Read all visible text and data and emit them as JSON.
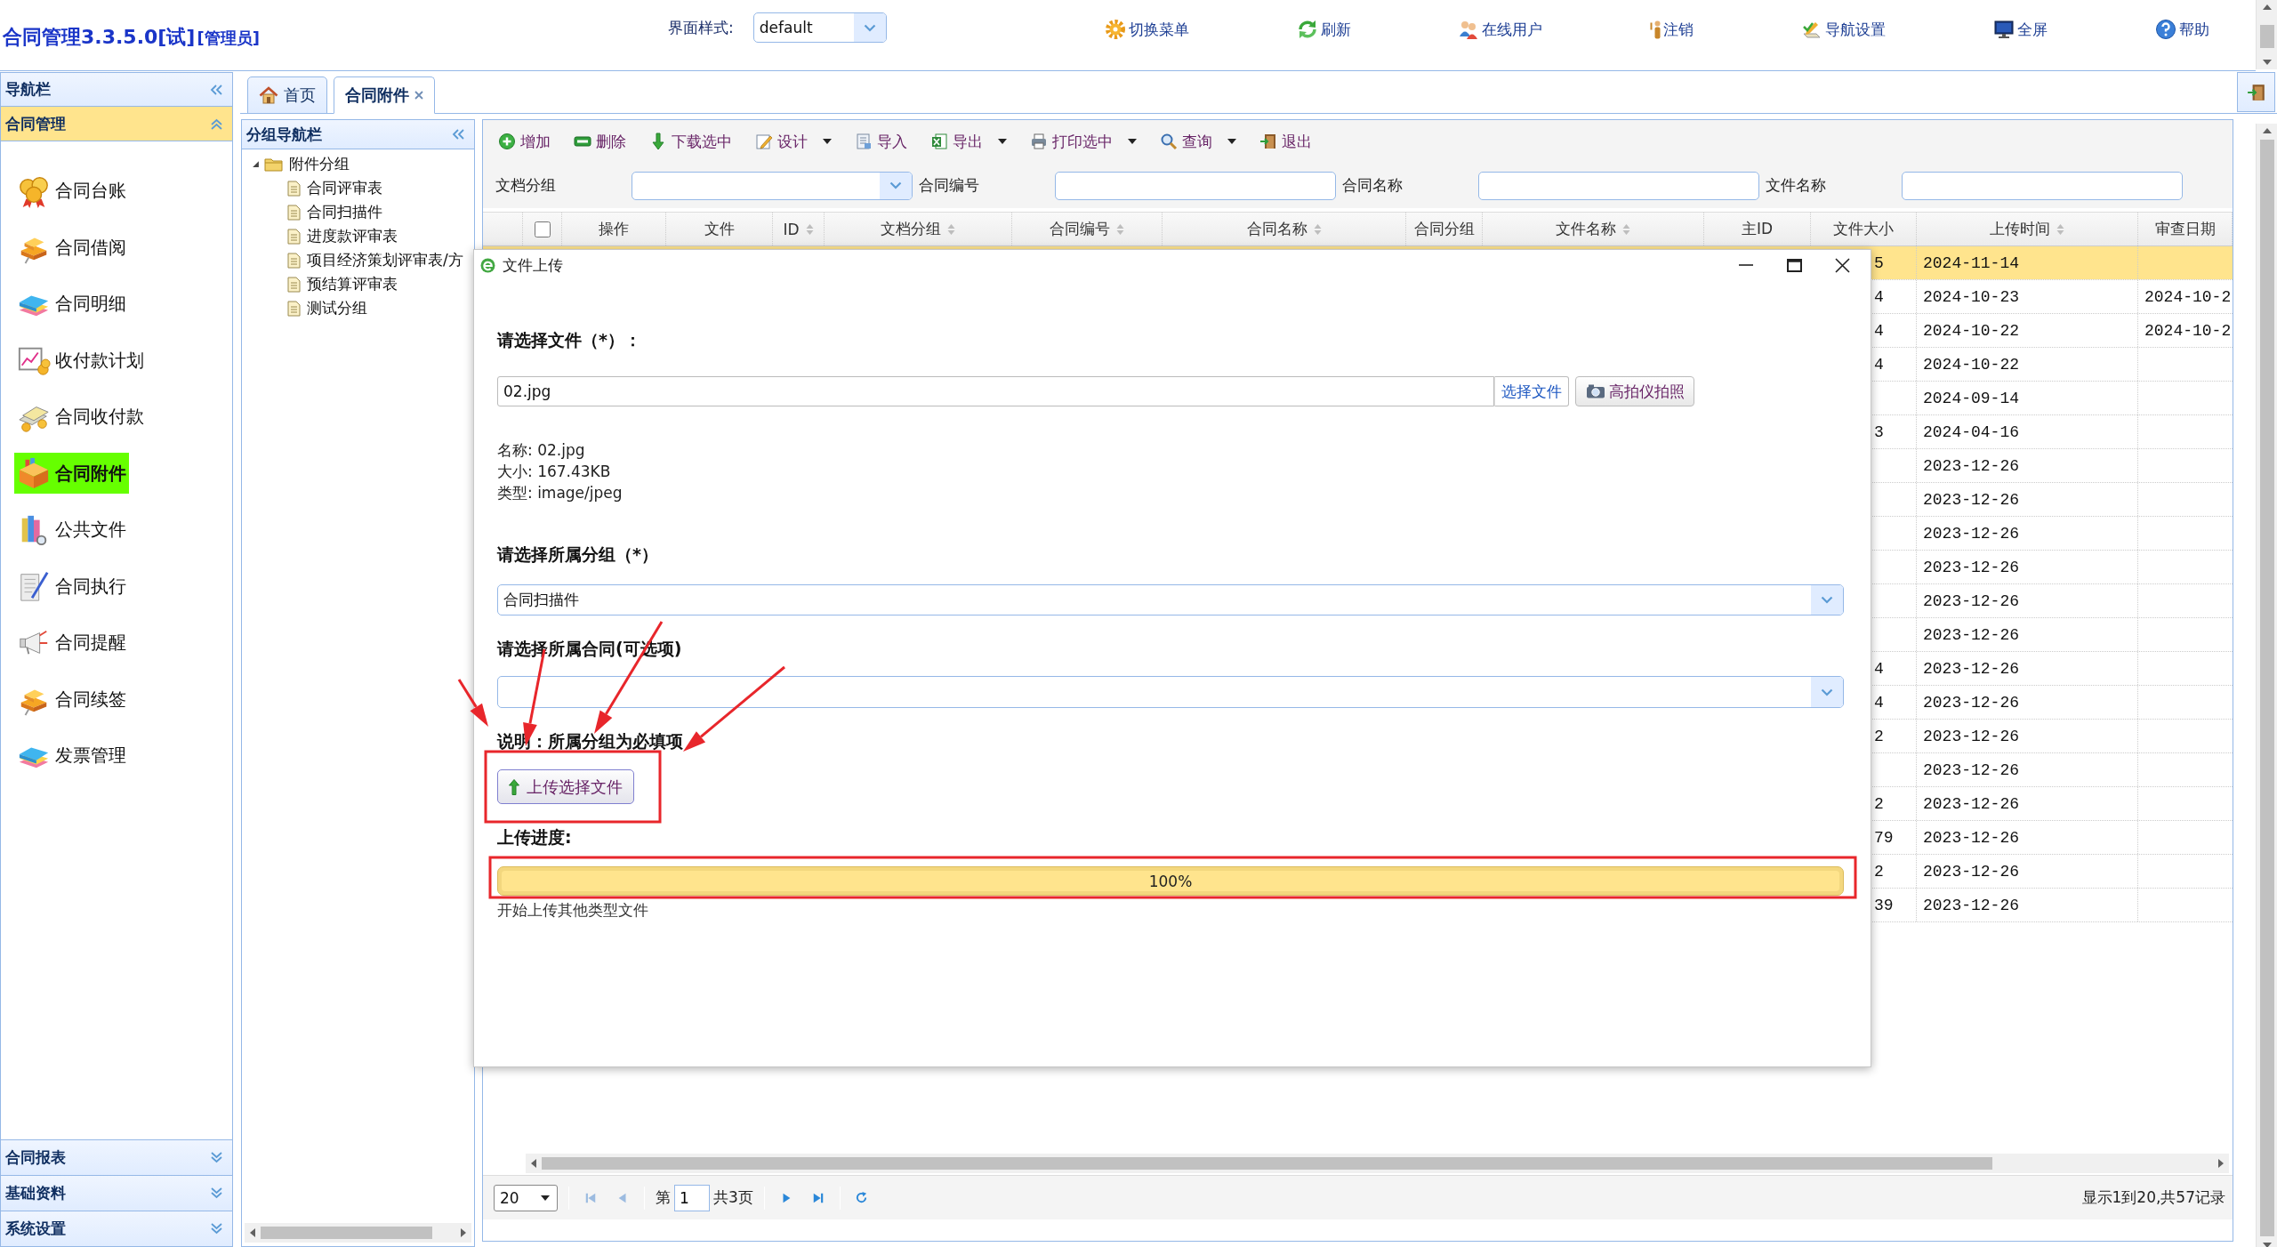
{
  "header": {
    "title": "合同管理3.3.5.0[试]",
    "role": "[管理员]",
    "theme_label": "界面样式:",
    "theme_value": "default",
    "actions": [
      "切换菜单",
      "刷新",
      "在线用户",
      "注销",
      "导航设置",
      "全屏",
      "帮助"
    ]
  },
  "nav": {
    "title": "导航栏",
    "group": {
      "label": "合同管理",
      "expanded": true
    },
    "items": [
      {
        "label": "合同台账",
        "selected": false
      },
      {
        "label": "合同借阅",
        "selected": false
      },
      {
        "label": "合同明细",
        "selected": false
      },
      {
        "label": "收付款计划",
        "selected": false
      },
      {
        "label": "合同收付款",
        "selected": false
      },
      {
        "label": "合同附件",
        "selected": true
      },
      {
        "label": "公共文件",
        "selected": false
      },
      {
        "label": "合同执行",
        "selected": false
      },
      {
        "label": "合同提醒",
        "selected": false
      },
      {
        "label": "合同续签",
        "selected": false
      },
      {
        "label": "发票管理",
        "selected": false
      }
    ],
    "sections": [
      {
        "label": "合同报表",
        "expanded": false
      },
      {
        "label": "基础资料",
        "expanded": false
      },
      {
        "label": "系统设置",
        "expanded": false
      }
    ]
  },
  "tabs": [
    {
      "label": "首页",
      "kind": "home",
      "selected": false,
      "closable": false
    },
    {
      "label": "合同附件",
      "kind": "page",
      "selected": true,
      "closable": true
    }
  ],
  "group_nav": {
    "title": "分组导航栏",
    "tree": [
      {
        "label": "附件分组",
        "expanded": true,
        "children": [
          {
            "label": "合同评审表"
          },
          {
            "label": "合同扫描件"
          },
          {
            "label": "进度款评审表"
          },
          {
            "label": "项目经济策划评审表/方"
          },
          {
            "label": "预结算评审表"
          },
          {
            "label": "测试分组"
          }
        ]
      }
    ]
  },
  "toolbar": [
    {
      "label": "增加",
      "menu": false
    },
    {
      "label": "删除",
      "menu": false
    },
    {
      "label": "下载选中",
      "menu": false
    },
    {
      "label": "设计",
      "menu": true
    },
    {
      "label": "导入",
      "menu": false
    },
    {
      "label": "导出",
      "menu": true
    },
    {
      "label": "打印选中",
      "menu": true
    },
    {
      "label": "查询",
      "menu": true
    },
    {
      "label": "退出",
      "menu": false
    }
  ],
  "filters": [
    {
      "label": "文档分组",
      "kind": "select"
    },
    {
      "label": "合同编号",
      "kind": "text"
    },
    {
      "label": "合同名称",
      "kind": "text"
    },
    {
      "label": "文件名称",
      "kind": "text"
    }
  ],
  "table": {
    "select_all": {
      "checked": false
    },
    "columns": [
      {
        "label": "操作",
        "sortable": false
      },
      {
        "label": "文件",
        "sortable": false
      },
      {
        "label": "ID",
        "sortable": true
      },
      {
        "label": "文档分组",
        "sortable": true
      },
      {
        "label": "合同编号",
        "sortable": true
      },
      {
        "label": "合同名称",
        "sortable": true
      },
      {
        "label": "合同分组",
        "sortable": false
      },
      {
        "label": "文件名称",
        "sortable": true
      },
      {
        "label": "主ID",
        "sortable": false
      },
      {
        "label": "文件大小",
        "sortable": false
      },
      {
        "label": "上传时间",
        "sortable": true
      },
      {
        "label": "审查日期",
        "sortable": false
      }
    ],
    "rows": [
      {
        "selected": true,
        "file_size": "5",
        "upload_time": "2024-11-14"
      },
      {
        "selected": false,
        "file_size": "4",
        "upload_time": "2024-10-23",
        "review_date": "2024-10-2"
      },
      {
        "selected": false,
        "file_size": "4",
        "upload_time": "2024-10-22",
        "review_date": "2024-10-2"
      },
      {
        "selected": false,
        "file_size": "4",
        "upload_time": "2024-10-22"
      },
      {
        "selected": false,
        "upload_time": "2024-09-14"
      },
      {
        "selected": false,
        "file_size": "3",
        "upload_time": "2024-04-16"
      },
      {
        "selected": false,
        "upload_time": "2023-12-26"
      },
      {
        "selected": false,
        "upload_time": "2023-12-26"
      },
      {
        "selected": false,
        "upload_time": "2023-12-26"
      },
      {
        "selected": false,
        "upload_time": "2023-12-26"
      },
      {
        "selected": false,
        "upload_time": "2023-12-26"
      },
      {
        "selected": false,
        "upload_time": "2023-12-26"
      },
      {
        "selected": false,
        "file_size": "4",
        "upload_time": "2023-12-26"
      },
      {
        "selected": false,
        "file_size": "4",
        "upload_time": "2023-12-26"
      },
      {
        "selected": false,
        "file_size": "2",
        "upload_time": "2023-12-26"
      },
      {
        "selected": false,
        "upload_time": "2023-12-26"
      },
      {
        "selected": false,
        "file_size": "2",
        "upload_time": "2023-12-26"
      },
      {
        "selected": false,
        "file_size": "79",
        "upload_time": "2023-12-26"
      },
      {
        "selected": false,
        "file_size": "2",
        "upload_time": "2023-12-26"
      },
      {
        "selected": false,
        "file_size": "39",
        "upload_time": "2023-12-26"
      }
    ]
  },
  "pager": {
    "page_size": "20",
    "page_prefix": "第",
    "page": "1",
    "page_suffix": "共3页",
    "summary": "显示1到20,共57记录",
    "can_go_back": false,
    "can_go_forward": true
  },
  "dialog": {
    "title": "文件上传",
    "file_label": "请选择文件（*）：",
    "file_value": "02.jpg",
    "browse_button": "选择文件",
    "camera_button": "高拍仪拍照",
    "file_info": [
      "名称: 02.jpg",
      "大小: 167.43KB",
      "类型: image/jpeg"
    ],
    "group_label": "请选择所属分组（*）",
    "group_value": "合同扫描件",
    "contract_label": "请选择所属合同(可选项)",
    "note": "说明：所属分组为必填项",
    "upload_button": "上传选择文件",
    "progress_label": "上传进度:",
    "progress": {
      "level": 1,
      "reading": "100%"
    },
    "status": "开始上传其他类型文件"
  }
}
